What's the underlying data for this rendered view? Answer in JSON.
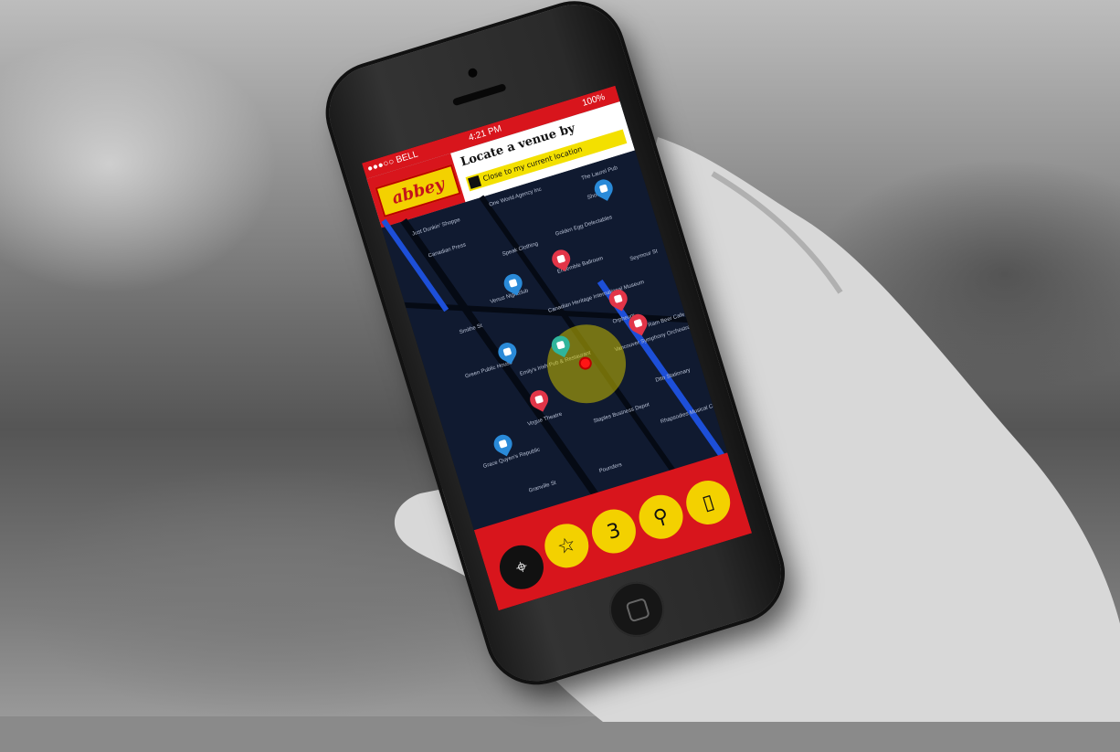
{
  "status_bar": {
    "carrier": "●●●○○ BELL",
    "time": "4:21 PM",
    "battery": "100%"
  },
  "header": {
    "logo_text": "abbey",
    "title": "Locate a venue by",
    "option_label": "Close to my current location"
  },
  "map": {
    "labels": [
      "Just Dunkin' Shoppe",
      "Canadian Press",
      "One World Agency Inc",
      "The Laurel Pub",
      "Shoebiz",
      "Speak Clothing",
      "Golden Egg Delectables",
      "Venus Nightclub",
      "Ensemble Ballroom",
      "Smithe St",
      "Canadian Heritage International Museum",
      "Emily's Irish Pub & Restaurant",
      "Orpheum",
      "Green Public House",
      "Vancouver Symphony Orchestra",
      "Ram Beer Cafe",
      "Vogue Theatre",
      "Grace Quyen's Republic",
      "Staples Business Depot",
      "Dtto Stationary",
      "Rhapsodies Musical Care",
      "Pounders",
      "Seymour St",
      "Granville St"
    ]
  },
  "toolbar": {
    "buttons": [
      {
        "name": "locate",
        "glyph": "⌖"
      },
      {
        "name": "favourites",
        "glyph": "☆"
      },
      {
        "name": "calendar",
        "glyph": "3"
      },
      {
        "name": "search",
        "glyph": "⚲"
      },
      {
        "name": "notebook",
        "glyph": "▯"
      }
    ]
  },
  "colors": {
    "brand_red": "#d8151c",
    "brand_yellow": "#f3d100",
    "map_bg": "#101a30",
    "venue_blue": "#2a8ad8",
    "venue_red": "#e23548",
    "venue_green": "#2fb59b"
  }
}
